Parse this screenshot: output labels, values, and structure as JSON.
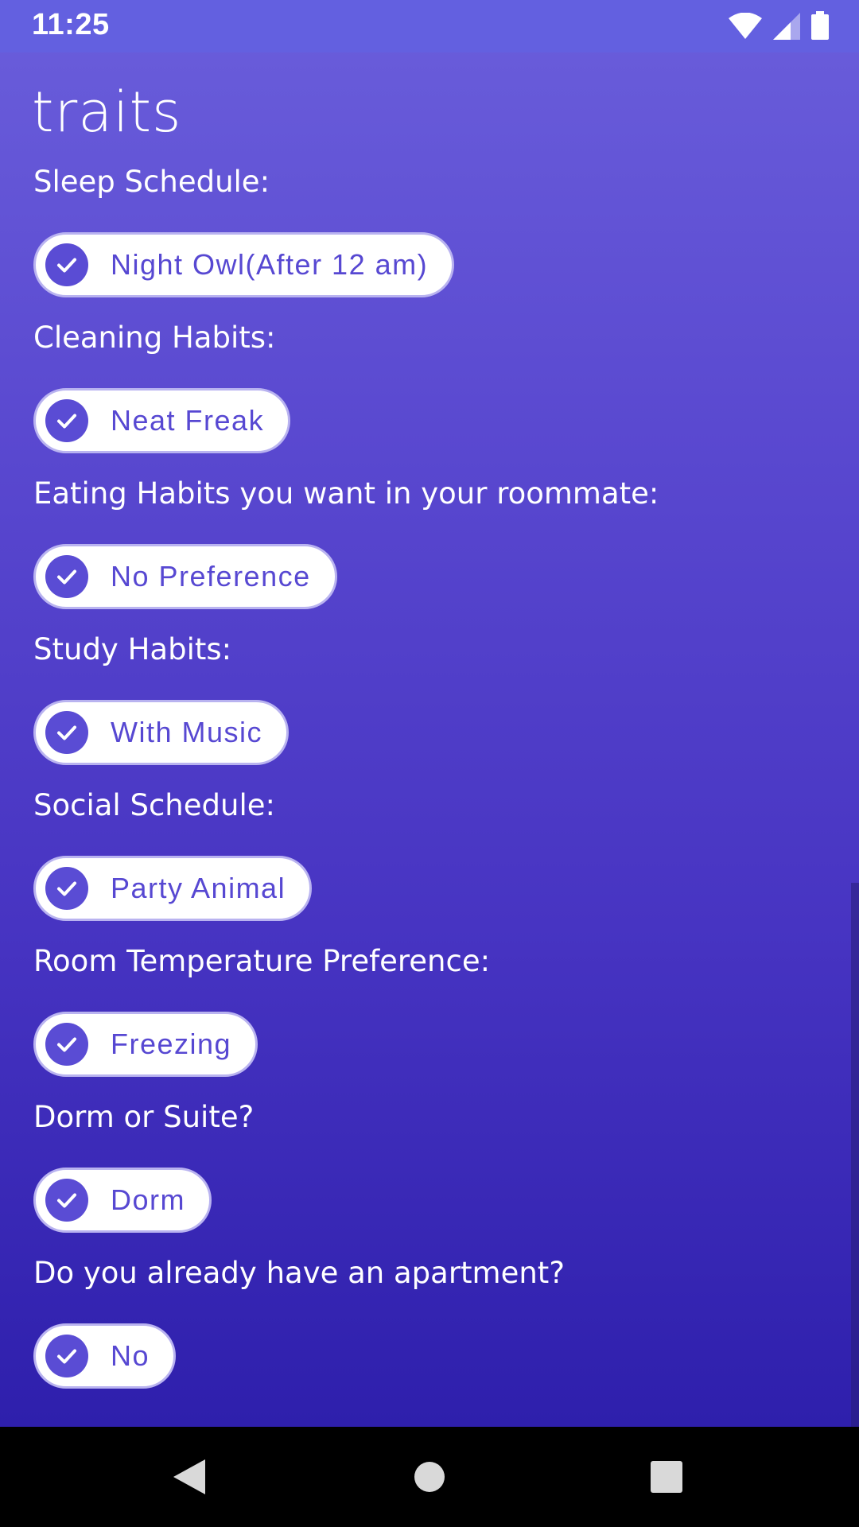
{
  "status_bar": {
    "time": "11:25"
  },
  "page": {
    "title": "traits"
  },
  "traits": [
    {
      "question": "Sleep Schedule:",
      "selected": "Night Owl(After 12 am)"
    },
    {
      "question": "Cleaning Habits:",
      "selected": "Neat Freak"
    },
    {
      "question": "Eating Habits you want in your roommate:",
      "selected": "No Preference"
    },
    {
      "question": "Study Habits:",
      "selected": "With Music"
    },
    {
      "question": "Social Schedule:",
      "selected": "Party Animal"
    },
    {
      "question": "Room Temperature Preference:",
      "selected": "Freezing"
    },
    {
      "question": "Dorm or Suite?",
      "selected": "Dorm"
    },
    {
      "question": "Do you already have an apartment?",
      "selected": "No"
    }
  ],
  "icons": {
    "chip": "check-circle-icon",
    "status": [
      "wifi-icon",
      "cell-signal-icon",
      "battery-icon"
    ],
    "nav": [
      "back-icon",
      "home-icon",
      "recents-icon"
    ]
  },
  "colors": {
    "gradient_top": "#6A5EDB",
    "gradient_bottom": "#2E1FAC",
    "chip_text": "#5748D2",
    "chip_check": "#5A4CD4"
  }
}
